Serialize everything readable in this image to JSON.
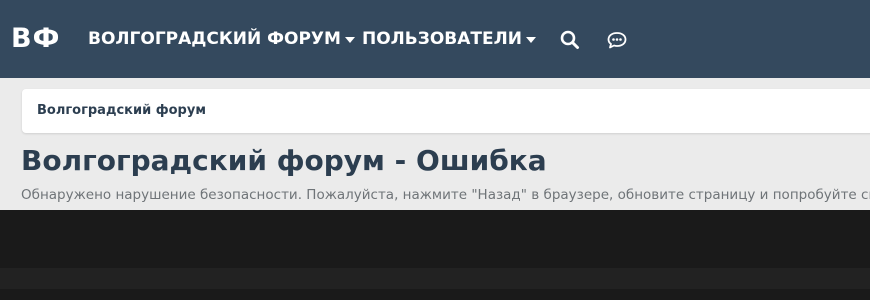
{
  "nav": {
    "logo": "ВФ",
    "forum_menu": "ВОЛГОГРАДСКИЙ ФОРУМ",
    "users_menu": "ПОЛЬЗОВАТЕЛИ",
    "search_icon": "search-icon",
    "chat_icon": "chat-bubble-icon"
  },
  "breadcrumb": {
    "home": "Волгоградский форум"
  },
  "main": {
    "title": "Волгоградский форум - Ошибка",
    "message": "Обнаружено нарушение безопасности. Пожалуйста, нажмите \"Назад\" в браузере, обновите страницу и попробуйте снова."
  },
  "colors": {
    "navbar": "#34495e",
    "page_background": "#ebebeb",
    "title_text": "#2c3e50",
    "message_text": "#6f7478",
    "footer": "#1a1a1a"
  }
}
